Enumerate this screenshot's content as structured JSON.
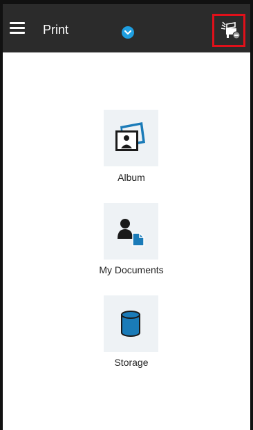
{
  "header": {
    "title": "Print",
    "menu_icon": "hamburger-menu-icon",
    "dropdown_icon": "chevron-down-icon",
    "printer_icon": "printer-status-icon",
    "background": "#2b2b2b",
    "accent": "#1e9ee0",
    "highlight": "#e0101a"
  },
  "sources": [
    {
      "label": "Album",
      "icon": "photo-album-icon"
    },
    {
      "label": "My Documents",
      "icon": "my-documents-icon"
    },
    {
      "label": "Storage",
      "icon": "storage-cylinder-icon"
    }
  ],
  "colors": {
    "icon_fill": "#1a7bb8",
    "tile_bg": "#eef2f5"
  }
}
